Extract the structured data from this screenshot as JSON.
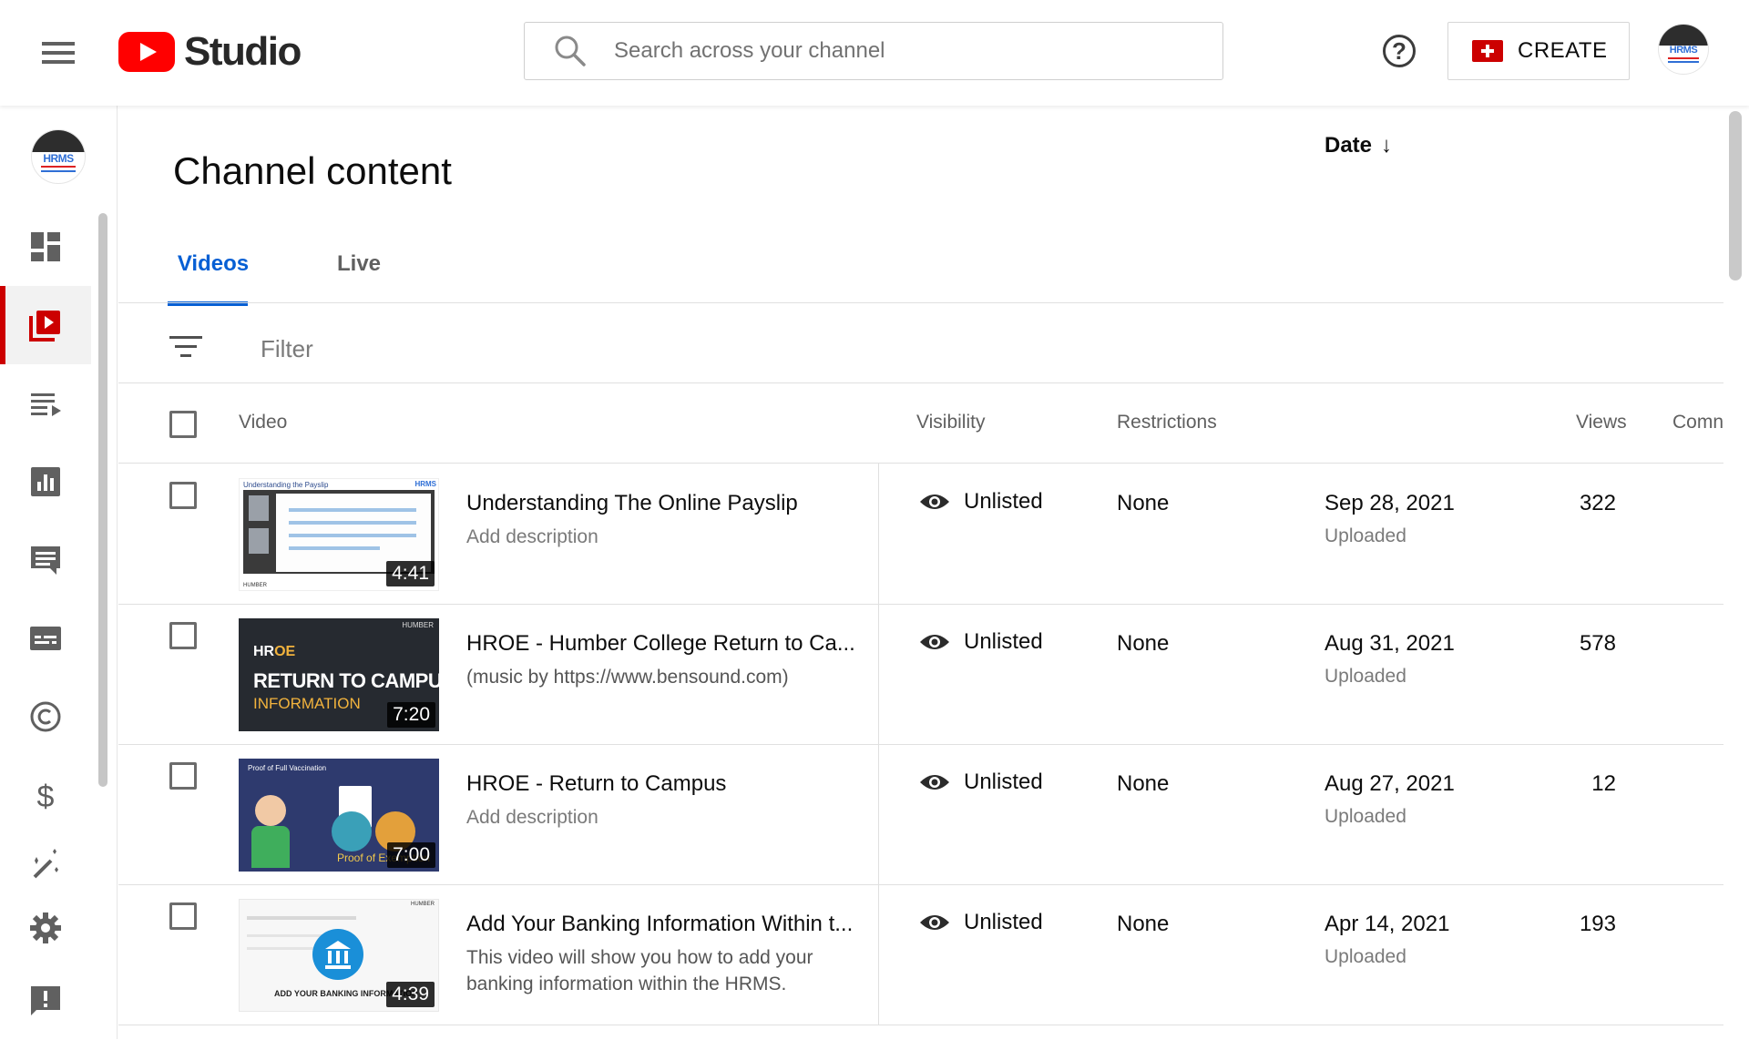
{
  "header": {
    "app_name": "Studio",
    "search_placeholder": "Search across your channel",
    "create_label": "CREATE",
    "help_symbol": "?",
    "avatar_text": "HRMS",
    "brand_color": "#ff0000"
  },
  "sidebar": {
    "avatar_text": "HRMS",
    "items": [
      {
        "icon": "dashboard-icon",
        "active": false
      },
      {
        "icon": "content-icon",
        "active": true
      },
      {
        "icon": "playlists-icon",
        "active": false
      },
      {
        "icon": "analytics-icon",
        "active": false
      },
      {
        "icon": "comments-icon",
        "active": false
      },
      {
        "icon": "subtitles-icon",
        "active": false
      },
      {
        "icon": "copyright-icon",
        "active": false
      },
      {
        "icon": "monetization-icon",
        "active": false
      },
      {
        "icon": "customization-icon",
        "active": false
      },
      {
        "icon": "settings-icon",
        "active": false
      },
      {
        "icon": "feedback-icon",
        "active": false
      }
    ]
  },
  "main": {
    "title": "Channel content",
    "tabs": [
      {
        "label": "Videos",
        "active": true
      },
      {
        "label": "Live",
        "active": false
      }
    ],
    "filter_placeholder": "Filter",
    "columns": {
      "video": "Video",
      "visibility": "Visibility",
      "restrictions": "Restrictions",
      "date": "Date",
      "date_sort": "↓",
      "views": "Views",
      "comments": "Comn"
    },
    "videos": [
      {
        "title": "Understanding The Online Payslip",
        "description": "Add description",
        "duration": "4:41",
        "visibility": "Unlisted",
        "restrictions": "None",
        "date": "Sep 28, 2021",
        "status": "Uploaded",
        "views": "322",
        "thumb_text": [
          "Understanding the Payslip",
          "HRMS",
          "HUMBER"
        ]
      },
      {
        "title": "HROE - Humber College Return to Ca...",
        "description": "(music by https://www.bensound.com)",
        "duration": "7:20",
        "visibility": "Unlisted",
        "restrictions": "None",
        "date": "Aug 31, 2021",
        "status": "Uploaded",
        "views": "578",
        "thumb_text": [
          "HUMBER",
          "HR",
          "OE",
          "RETURN TO CAMPUS",
          "INFORMATION"
        ]
      },
      {
        "title": "HROE - Return to Campus",
        "description": "Add description",
        "duration": "7:00",
        "visibility": "Unlisted",
        "restrictions": "None",
        "date": "Aug 27, 2021",
        "status": "Uploaded",
        "views": "12",
        "thumb_text": [
          "Proof of Full Vaccination",
          "Proof of Exemption"
        ]
      },
      {
        "title": "Add Your Banking Information Within t...",
        "description": "This video will show you how to add your banking information within the HRMS.",
        "duration": "4:39",
        "visibility": "Unlisted",
        "restrictions": "None",
        "date": "Apr 14, 2021",
        "status": "Uploaded",
        "views": "193",
        "thumb_text": [
          "HUMBER",
          "ADD YOUR BANKING INFORMATION"
        ]
      }
    ]
  }
}
